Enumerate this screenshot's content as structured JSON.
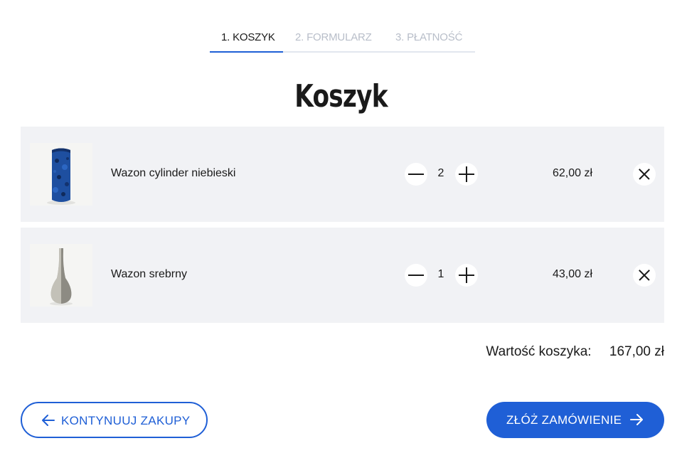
{
  "steps": [
    {
      "label": "1. KOSZYK",
      "active": true
    },
    {
      "label": "2. FORMULARZ",
      "active": false
    },
    {
      "label": "3. PŁATNOŚĆ",
      "active": false
    }
  ],
  "title": "Koszyk",
  "items": [
    {
      "name": "Wazon cylinder niebieski",
      "qty": "2",
      "price": "62,00 zł",
      "image": "blue-cylinder-vase"
    },
    {
      "name": "Wazon srebrny",
      "qty": "1",
      "price": "43,00 zł",
      "image": "silver-vase"
    }
  ],
  "summary": {
    "label": "Wartość koszyka:",
    "value": "167,00 zł"
  },
  "buttons": {
    "continue": "KONTYNUUJ ZAKUPY",
    "order": "ZŁÓŻ ZAMÓWIENIE"
  },
  "colors": {
    "accent": "#1f5fd6",
    "row_bg": "#f1f2f5",
    "inactive_step": "#b8bec9"
  },
  "icons": {
    "minus": "minus-icon",
    "plus": "plus-icon",
    "remove": "close-icon",
    "back": "arrow-left-icon",
    "forward": "arrow-right-icon"
  }
}
